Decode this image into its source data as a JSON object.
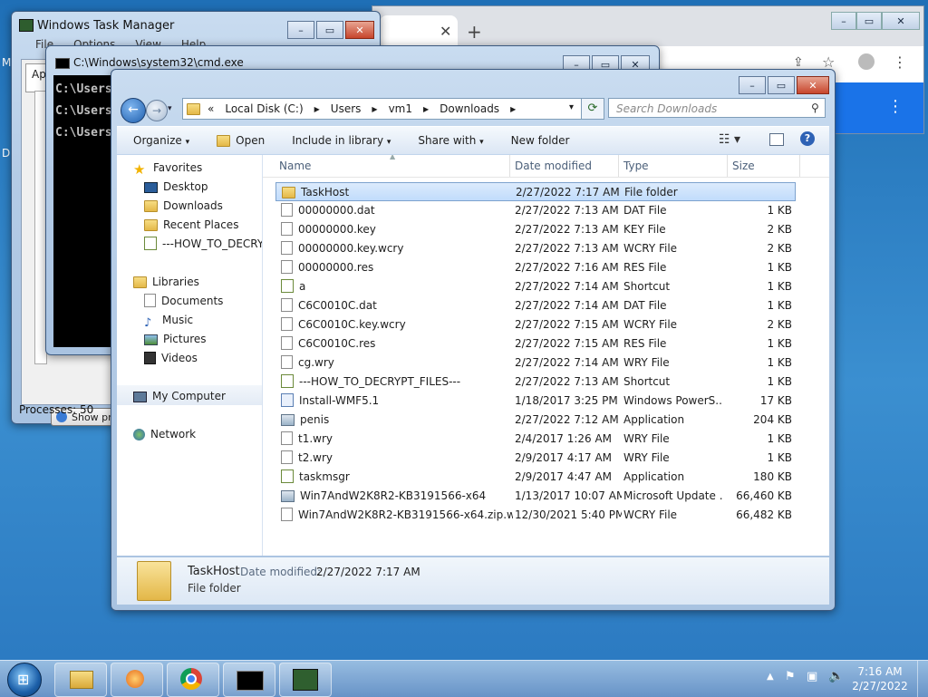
{
  "task_manager": {
    "title": "Windows Task Manager",
    "menu": [
      "File",
      "Options",
      "View",
      "Help"
    ],
    "tab_partial": "App",
    "show_processes_label": "Show proce",
    "processes_status": "Processes: 50"
  },
  "cmd": {
    "title": "C:\\Windows\\system32\\cmd.exe",
    "lines": [
      "C:\\Users",
      "C:\\Users",
      "C:\\Users"
    ]
  },
  "explorer": {
    "address": {
      "prefix": "«",
      "crumbs": [
        "Local Disk (C:)",
        "Users",
        "vm1",
        "Downloads"
      ]
    },
    "search_placeholder": "Search Downloads",
    "toolbar": {
      "organize": "Organize",
      "open": "Open",
      "include": "Include in library",
      "share": "Share with",
      "new_folder": "New folder"
    },
    "nav": {
      "favorites": "Favorites",
      "desktop": "Desktop",
      "downloads": "Downloads",
      "recent": "Recent Places",
      "howto": "---HOW_TO_DECRY",
      "libraries": "Libraries",
      "documents": "Documents",
      "music": "Music",
      "pictures": "Pictures",
      "videos": "Videos",
      "computer": "My Computer",
      "network": "Network"
    },
    "columns": {
      "name": "Name",
      "date": "Date modified",
      "type": "Type",
      "size": "Size"
    },
    "files": [
      {
        "name": "TaskHost",
        "date": "2/27/2022 7:17 AM",
        "type": "File folder",
        "size": "",
        "icon": "folder"
      },
      {
        "name": "00000000.dat",
        "date": "2/27/2022 7:13 AM",
        "type": "DAT File",
        "size": "1 KB",
        "icon": "file"
      },
      {
        "name": "00000000.key",
        "date": "2/27/2022 7:13 AM",
        "type": "KEY File",
        "size": "2 KB",
        "icon": "file"
      },
      {
        "name": "00000000.key.wcry",
        "date": "2/27/2022 7:13 AM",
        "type": "WCRY File",
        "size": "2 KB",
        "icon": "file"
      },
      {
        "name": "00000000.res",
        "date": "2/27/2022 7:16 AM",
        "type": "RES File",
        "size": "1 KB",
        "icon": "file"
      },
      {
        "name": "a",
        "date": "2/27/2022 7:14 AM",
        "type": "Shortcut",
        "size": "1 KB",
        "icon": "short"
      },
      {
        "name": "C6C0010C.dat",
        "date": "2/27/2022 7:14 AM",
        "type": "DAT File",
        "size": "1 KB",
        "icon": "file"
      },
      {
        "name": "C6C0010C.key.wcry",
        "date": "2/27/2022 7:15 AM",
        "type": "WCRY File",
        "size": "2 KB",
        "icon": "file"
      },
      {
        "name": "C6C0010C.res",
        "date": "2/27/2022 7:15 AM",
        "type": "RES File",
        "size": "1 KB",
        "icon": "file"
      },
      {
        "name": "cg.wry",
        "date": "2/27/2022 7:14 AM",
        "type": "WRY File",
        "size": "1 KB",
        "icon": "file"
      },
      {
        "name": "---HOW_TO_DECRYPT_FILES---",
        "date": "2/27/2022 7:13 AM",
        "type": "Shortcut",
        "size": "1 KB",
        "icon": "short"
      },
      {
        "name": "Install-WMF5.1",
        "date": "1/18/2017 3:25 PM",
        "type": "Windows PowerS...",
        "size": "17 KB",
        "icon": "ps"
      },
      {
        "name": "penis",
        "date": "2/27/2022 7:12 AM",
        "type": "Application",
        "size": "204 KB",
        "icon": "app"
      },
      {
        "name": "t1.wry",
        "date": "2/4/2017 1:26 AM",
        "type": "WRY File",
        "size": "1 KB",
        "icon": "file"
      },
      {
        "name": "t2.wry",
        "date": "2/9/2017 4:17 AM",
        "type": "WRY File",
        "size": "1 KB",
        "icon": "file"
      },
      {
        "name": "taskmsgr",
        "date": "2/9/2017 4:47 AM",
        "type": "Application",
        "size": "180 KB",
        "icon": "short"
      },
      {
        "name": "Win7AndW2K8R2-KB3191566-x64",
        "date": "1/13/2017 10:07 AM",
        "type": "Microsoft Update ...",
        "size": "66,460 KB",
        "icon": "app"
      },
      {
        "name": "Win7AndW2K8R2-KB3191566-x64.zip.wcry",
        "date": "12/30/2021 5:40 PM",
        "type": "WCRY File",
        "size": "66,482 KB",
        "icon": "file"
      }
    ],
    "details": {
      "name": "TaskHost",
      "date_label": "Date modified:",
      "date_value": "2/27/2022 7:17 AM",
      "type": "File folder"
    }
  },
  "taskbar": {
    "time": "7:16 AM",
    "date": "2/27/2022"
  },
  "colors": {
    "selection": "#c1dcfc",
    "taskbar": "#6e96c8",
    "console": "#000000"
  }
}
